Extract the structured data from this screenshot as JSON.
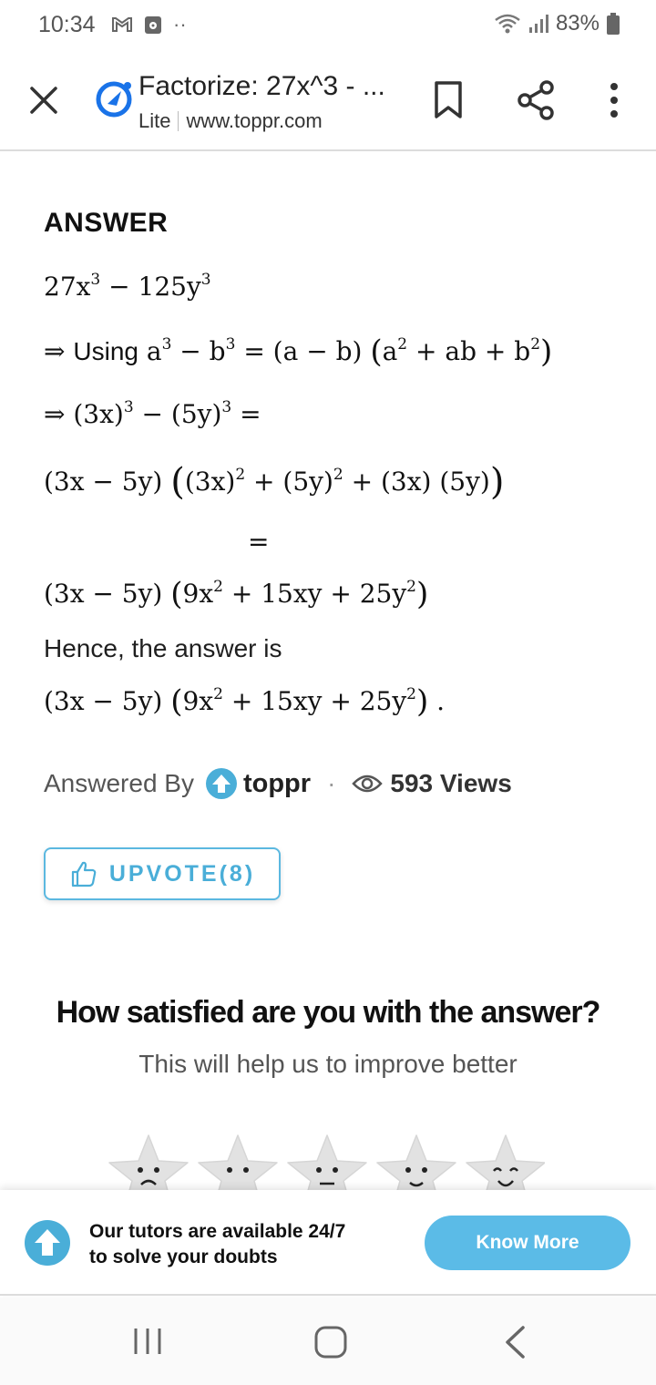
{
  "status_bar": {
    "time": "10:34",
    "battery": "83%",
    "overflow": "··"
  },
  "app_bar": {
    "title": "Factorize: 27x^3 - ...",
    "mode": "Lite",
    "url": "www.toppr.com"
  },
  "answer": {
    "heading": "ANSWER",
    "using_label": "Using",
    "hence_text": "Hence, the answer is",
    "lines": {
      "l1": {
        "a": "27x",
        "e1": "3",
        "b": " − 125y",
        "e2": "3"
      },
      "l2": {
        "a": "a",
        "e1": "3",
        "b": " − b",
        "e2": "3",
        "c": " = (a − b) ",
        "open": "(",
        "d": "a",
        "e3": "2",
        "e": " + ab + b",
        "e4": "2",
        "close": ")"
      },
      "l3": {
        "a": "⇒ ",
        "b": "(3x)",
        "e1": "3",
        "c": " − (5y)",
        "e2": "3",
        "d": " ="
      },
      "l4": {
        "a": "(3x − 5y) ",
        "open": "(",
        "b": "(3x)",
        "e1": "2",
        "c": " + (5y)",
        "e2": "2",
        "d": " + (3x) (5y)",
        "close": ")"
      },
      "l5": {
        "a": "="
      },
      "l6": {
        "a": "(3x − 5y) ",
        "open": "(",
        "b": "9x",
        "e1": "2",
        "c": " + 15xy + 25y",
        "e2": "2",
        "close": ")"
      },
      "l7": {
        "a": "(3x − 5y) ",
        "open": "(",
        "b": "9x",
        "e1": "2",
        "c": " + 15xy + 25y",
        "e2": "2",
        "close": ")",
        "end": " ."
      }
    },
    "arrow": "⇒ "
  },
  "meta": {
    "answered_by": "Answered By",
    "brand": "toppr",
    "separator": "·",
    "views": "593 Views"
  },
  "upvote": {
    "label": "UPVOTE(8)",
    "color": "#4aaed8"
  },
  "satisfaction": {
    "title": "How satisfied are you with the answer?",
    "subtitle": "This will help us to improve better",
    "ratings": [
      "very-unsatisfied-star-icon",
      "unsatisfied-star-icon",
      "neutral-star-icon",
      "satisfied-star-icon",
      "very-satisfied-star-icon"
    ]
  },
  "banner": {
    "line1": "Our tutors are available 24/7",
    "line2": "to solve your doubts",
    "button": "Know More",
    "accent": "#5bbbe7"
  }
}
